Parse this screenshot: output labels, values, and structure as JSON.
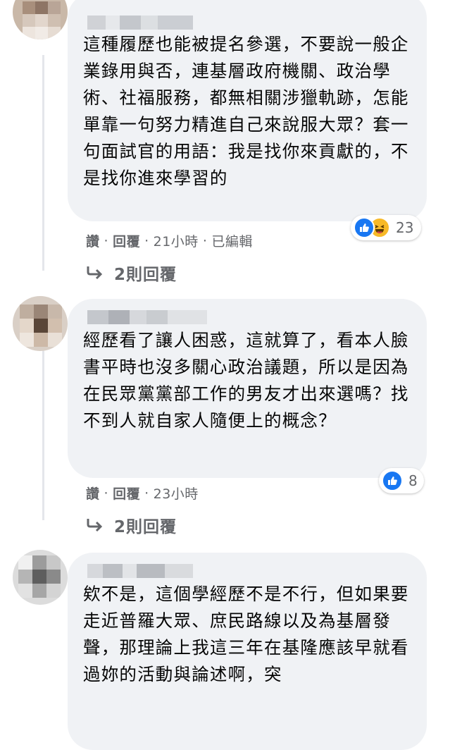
{
  "comments": [
    {
      "text": "這種履歷也能被提名參選，不要說一般企業錄用與否，連基層政府機關、政治學術、社福服務，都無相關涉獵軌跡，怎能單靠一句努力精進自己來說服大眾？套一句面試官的用語：我是找你來貢獻的，不是找你進來學習的",
      "reaction_count": "23",
      "reaction_icons": [
        "like-icon",
        "haha-icon"
      ],
      "actions": {
        "like": "讚",
        "reply": "回覆",
        "time": "21小時",
        "edited": "已編輯"
      },
      "replies_label": "2則回覆"
    },
    {
      "text": "經歷看了讓人困惑，這就算了，看本人臉書平時也沒多關心政治議題，所以是因為在民眾黨黨部工作的男友才出來選嗎？找不到人就自家人隨便上的概念？",
      "reaction_count": "8",
      "reaction_icons": [
        "like-icon"
      ],
      "actions": {
        "like": "讚",
        "reply": "回覆",
        "time": "23小時"
      },
      "replies_label": "2則回覆"
    },
    {
      "text": "欸不是，這個學經歷不是不行，但如果要走近普羅大眾、庶民路線以及為基層發聲，那理論上我這三年在基隆應該早就看過妳的活動與論述啊，突"
    }
  ],
  "colors": {
    "bubble": "#f0f2f5",
    "meta": "#65676b",
    "like": "#1877f2",
    "haha": "#f7b928"
  },
  "separator": "·"
}
